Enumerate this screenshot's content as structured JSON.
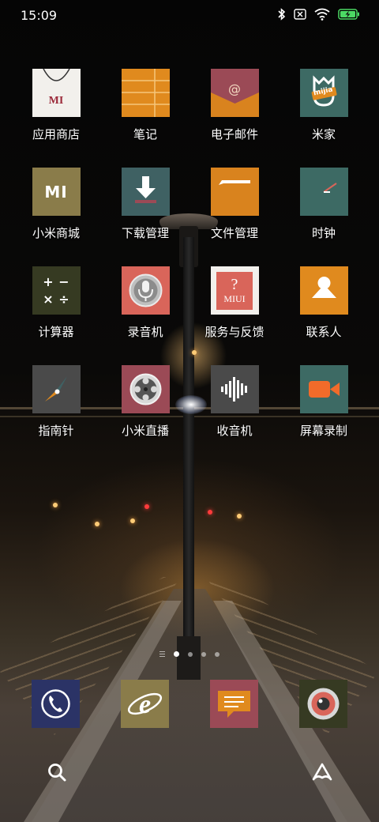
{
  "status_bar": {
    "time": "15:09",
    "icons": [
      "bluetooth-icon",
      "sim-card-icon",
      "wifi-icon",
      "battery-charging-icon"
    ],
    "battery_color": "#4cd964"
  },
  "apps": [
    {
      "name": "app-store",
      "label": "应用商店",
      "icon": "mi-shopping-bag-icon",
      "color": "#f2f0ec",
      "badge_text": "MI"
    },
    {
      "name": "notes",
      "label": "笔记",
      "icon": "notes-icon",
      "color": "#e08a1e"
    },
    {
      "name": "email",
      "label": "电子邮件",
      "icon": "email-envelope-icon",
      "color": "#d9831e",
      "badge_text": "@"
    },
    {
      "name": "mijia",
      "label": "米家",
      "icon": "mijia-icon",
      "color": "#3d6a64",
      "badge_text": "mijia"
    },
    {
      "name": "mi-store",
      "label": "小米商城",
      "icon": "mi-logo-icon",
      "color": "#8a7c4a",
      "badge_text": "MI"
    },
    {
      "name": "downloads",
      "label": "下载管理",
      "icon": "download-arrow-icon",
      "color": "#3f6163"
    },
    {
      "name": "file-manager",
      "label": "文件管理",
      "icon": "folder-icon",
      "color": "#d9831e"
    },
    {
      "name": "clock",
      "label": "时钟",
      "icon": "clock-icon",
      "color": "#3d6a64"
    },
    {
      "name": "calculator",
      "label": "计算器",
      "icon": "calculator-icon",
      "color": "#363a22",
      "badge_text": [
        "+",
        "−",
        "×",
        "÷"
      ]
    },
    {
      "name": "recorder",
      "label": "录音机",
      "icon": "microphone-icon",
      "color": "#d9655a"
    },
    {
      "name": "feedback",
      "label": "服务与反馈",
      "icon": "feedback-icon",
      "color": "#f2f0ec",
      "badge_text": [
        "?",
        "MIUI"
      ]
    },
    {
      "name": "contacts",
      "label": "联系人",
      "icon": "person-icon",
      "color": "#e08a1e"
    },
    {
      "name": "compass",
      "label": "指南针",
      "icon": "compass-icon",
      "color": "#4a4a4a"
    },
    {
      "name": "mi-live",
      "label": "小米直播",
      "icon": "film-reel-icon",
      "color": "#9b4a56"
    },
    {
      "name": "radio",
      "label": "收音机",
      "icon": "radio-waveform-icon",
      "color": "#4a4a4a"
    },
    {
      "name": "screen-recorder",
      "label": "屏幕录制",
      "icon": "video-camera-icon",
      "color": "#3d6a64"
    }
  ],
  "page_indicator": {
    "pages": 4,
    "active_page": 1
  },
  "dock": [
    {
      "name": "phone",
      "icon": "phone-icon",
      "color": "#2b3366"
    },
    {
      "name": "browser",
      "icon": "browser-e-icon",
      "color": "#8a7c4a"
    },
    {
      "name": "messages",
      "icon": "message-bubble-icon",
      "color": "#9b4a56"
    },
    {
      "name": "camera",
      "icon": "camera-lens-icon",
      "color": "#363a22"
    }
  ],
  "bottom_actions": [
    {
      "name": "search",
      "icon": "search-icon"
    },
    {
      "name": "assistant",
      "icon": "assistant-icon"
    }
  ]
}
